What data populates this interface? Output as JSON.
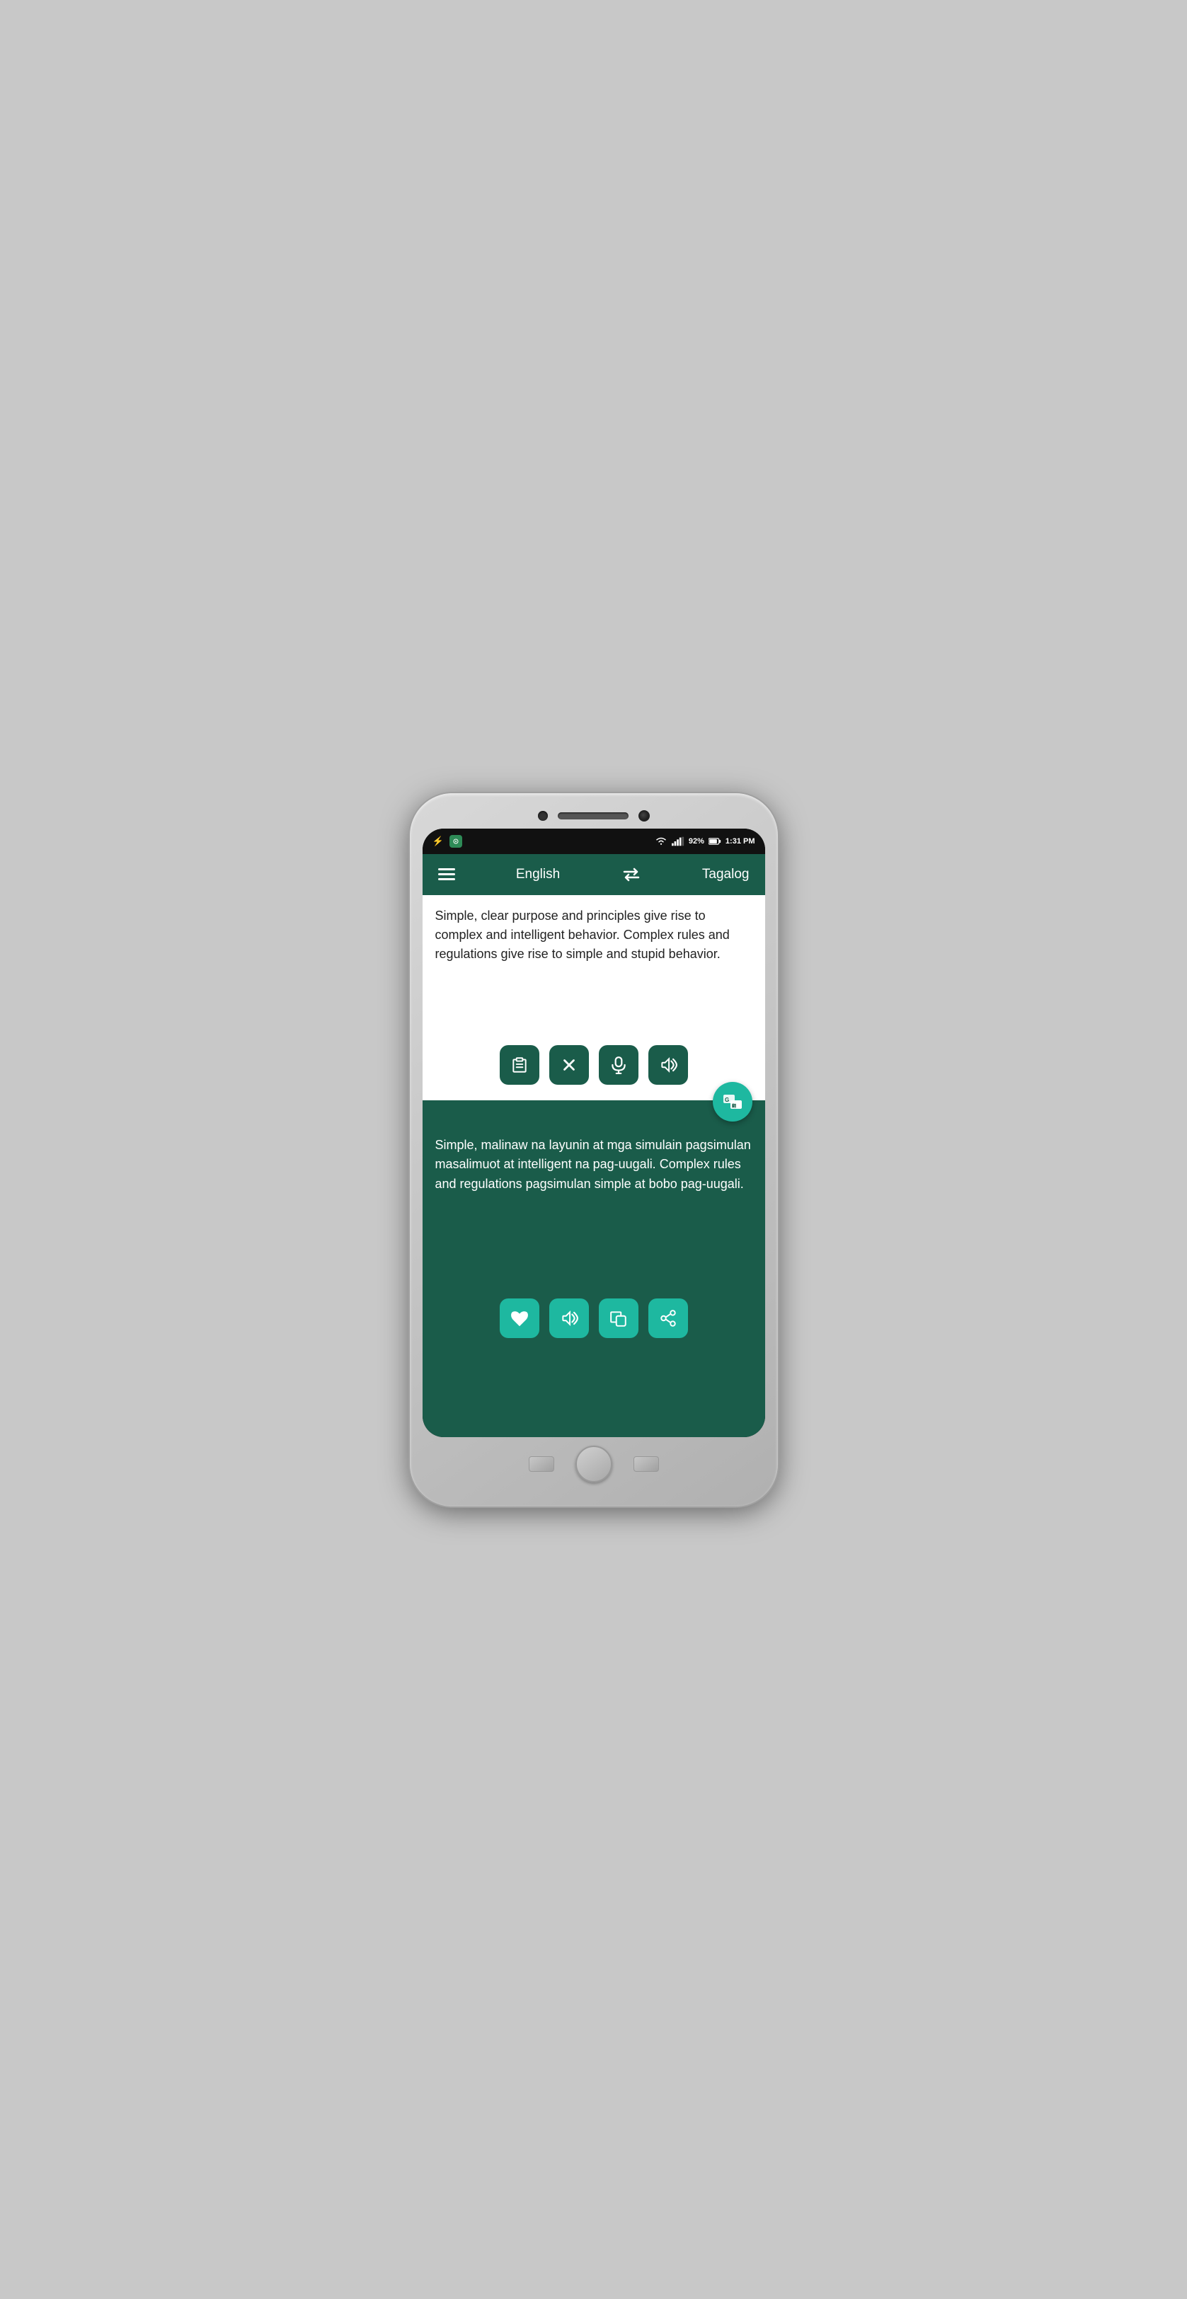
{
  "phone": {
    "status_bar": {
      "time": "1:31 PM",
      "battery": "92%",
      "battery_charging": true,
      "signal": "4",
      "wifi": true
    },
    "header": {
      "menu_icon": "hamburger-icon",
      "source_lang": "English",
      "swap_icon": "⇄",
      "target_lang": "Tagalog"
    },
    "input": {
      "text": "Simple, clear purpose and principles give rise to complex and intelligent behavior. Complex rules and regulations give rise to simple and stupid behavior.",
      "actions": [
        {
          "label": "clipboard",
          "icon": "clipboard"
        },
        {
          "label": "clear",
          "icon": "×"
        },
        {
          "label": "microphone",
          "icon": "mic"
        },
        {
          "label": "speaker",
          "icon": "speaker"
        }
      ]
    },
    "output": {
      "text": "Simple, malinaw na layunin at mga simulain pagsimulan masalimuot at intelligent na pag-uugali. Complex rules and regulations pagsimulan simple at bobo pag-uugali.",
      "actions": [
        {
          "label": "favorite",
          "icon": "heart"
        },
        {
          "label": "speaker",
          "icon": "speaker"
        },
        {
          "label": "copy",
          "icon": "copy"
        },
        {
          "label": "share",
          "icon": "share"
        }
      ]
    },
    "gtranslate_label": "G|",
    "colors": {
      "dark_green": "#1a5c4a",
      "teal": "#1eb8a0",
      "white": "#ffffff"
    }
  }
}
